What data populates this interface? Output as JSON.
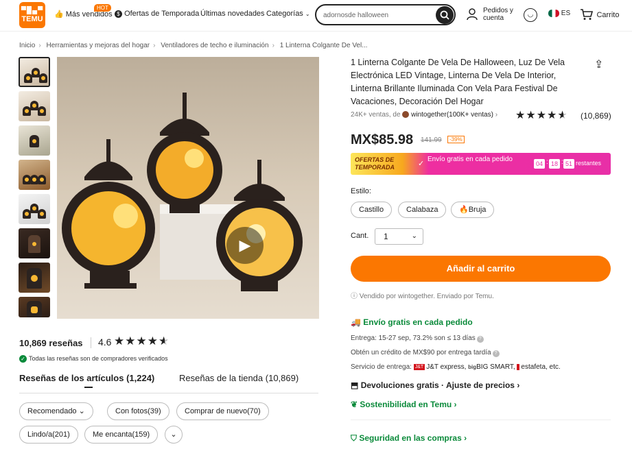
{
  "header": {
    "logo_text": "TEMU",
    "logo_glyphs": "▀█▄▀",
    "nav": [
      {
        "label": "Más vendidos",
        "badge": "HOT"
      },
      {
        "label": "Ofertas de Temporada"
      },
      {
        "label": "Últimas novedades"
      },
      {
        "label": "Categorías"
      }
    ],
    "search_value": "adornosde halloween",
    "account_label": "Pedidos y cuenta",
    "language": "ES",
    "cart_label": "Carrito"
  },
  "breadcrumb": [
    "Inicio",
    "Herramientas y mejoras del hogar",
    "Ventiladores de techo e iluminación",
    "1 Linterna Colgante De Vel..."
  ],
  "product": {
    "title": "1 Linterna Colgante De Vela De Halloween, Luz De Vela Electrónica LED Vintage, Linterna De Vela De Interior, Linterna Brillante Iluminada Con Vela Para Festival De Vacaciones, Decoración Del Hogar",
    "sales_prefix": "24K+ ventas, de",
    "seller": "wintogether(100K+ ventas)",
    "rating_count": "(10,869)",
    "price": "MX$85.98",
    "old_price": "141.99",
    "discount": "-39%",
    "promo": {
      "ofertas": "OFERTAS DE TEMPORADA",
      "envio": "Envío gratis en cada pedido",
      "countdown": [
        "04",
        "18",
        "51"
      ],
      "rest_label": "restantes"
    },
    "estilo_label": "Estilo:",
    "estilos": [
      "Castillo",
      "Calabaza",
      "Bruja"
    ],
    "cant_label": "Cant.",
    "quantity": "1",
    "add_to_cart": "Añadir al carrito",
    "sold_by": "Vendido por wintogether. Enviado por Temu.",
    "free_shipping": "Envío gratis en cada pedido",
    "delivery": "Entrega: 15-27 sep, 73.2% son ≤ 13 días",
    "credit": "Obtén un crédito de MX$90 por entrega tardía",
    "service_prefix": "Servicio de entrega:",
    "carriers": [
      "J&T express,",
      "BIG SMART,",
      "estafeta, etc."
    ],
    "returns": "Devoluciones gratis · Ajuste de precios",
    "sustainability": "Sostenibilidad en Temu",
    "security": "Seguridad en las compras"
  },
  "reviews": {
    "count": "10,869 reseñas",
    "score": "4.6",
    "rating_value": 4.6,
    "verified": "Todas las reseñas son de compradores verificados",
    "tabs": [
      "Reseñas de los artículos (1,224)",
      "Reseñas de la tienda (10,869)"
    ],
    "filters": [
      "Recomendado",
      "Con fotos(39)",
      "Comprar de nuevo(70)",
      "Lindo/a(201)",
      "Me encanta(159)"
    ]
  },
  "colors": {
    "accent": "#fb7701",
    "green": "#0a8a3a",
    "promo_pink": "#e82fa7"
  }
}
